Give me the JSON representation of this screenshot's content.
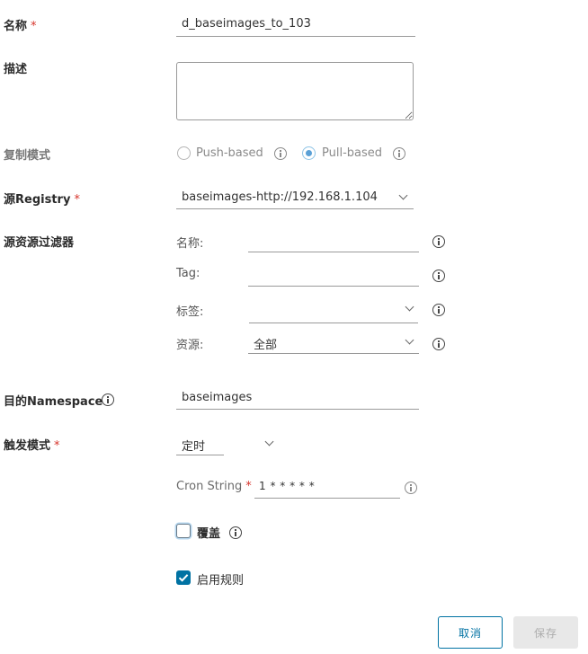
{
  "form": {
    "required_mark": "*",
    "name": {
      "label": "名称",
      "value": "d_baseimages_to_103"
    },
    "description": {
      "label": "描述",
      "value": ""
    },
    "replication_mode": {
      "label": "复制模式",
      "options": [
        {
          "label": "Push-based",
          "selected": false
        },
        {
          "label": "Pull-based",
          "selected": true
        }
      ]
    },
    "source_registry": {
      "label": "源Registry",
      "value": "baseimages-http://192.168.1.104"
    },
    "source_filter": {
      "label": "源资源过滤器",
      "name": {
        "label": "名称:",
        "value": ""
      },
      "tag": {
        "label": "Tag:",
        "value": ""
      },
      "label_filter": {
        "label": "标签:",
        "value": ""
      },
      "resource": {
        "label": "资源:",
        "value": "全部"
      }
    },
    "dest_namespace": {
      "label": "目的Namespace",
      "value": "baseimages"
    },
    "trigger_mode": {
      "label": "触发模式",
      "value": "定时",
      "cron": {
        "label": "Cron String",
        "value": "1 * * * * *"
      }
    },
    "override": {
      "label": "覆盖",
      "checked": false
    },
    "enable_rule": {
      "label": "启用规则",
      "checked": true
    }
  },
  "actions": {
    "cancel": "取消",
    "save": "保存"
  },
  "colors": {
    "accent": "#0072a3",
    "required": "#d6332b",
    "disabled_bg": "#e8e8e8",
    "disabled_text": "#adadad"
  }
}
